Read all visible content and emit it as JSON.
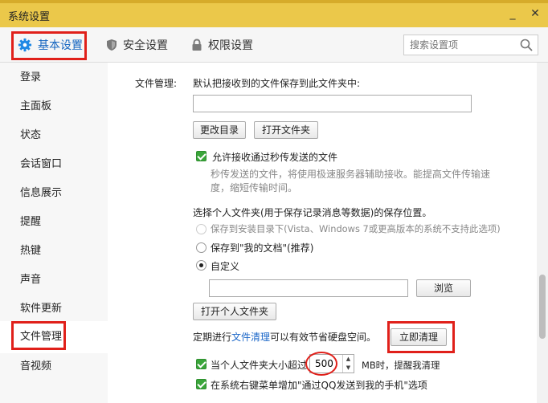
{
  "window": {
    "title": "系统设置",
    "minimize": "_",
    "close": "✕"
  },
  "toolbar": {
    "tabs": [
      {
        "label": "基本设置",
        "icon": "gear-icon"
      },
      {
        "label": "安全设置",
        "icon": "shield-icon"
      },
      {
        "label": "权限设置",
        "icon": "lock-icon"
      }
    ],
    "search_placeholder": "搜索设置项"
  },
  "sidebar": {
    "items": [
      "登录",
      "主面板",
      "状态",
      "会话窗口",
      "信息展示",
      "提醒",
      "热键",
      "声音",
      "软件更新",
      "文件管理",
      "音视频"
    ],
    "active_index": 9
  },
  "file_management": {
    "section_label": "文件管理:",
    "save_folder_text": "默认把接收到的文件保存到此文件夹中:",
    "path_value": "",
    "change_dir_button": "更改目录",
    "open_folder_button": "打开文件夹",
    "allow_flash_label": "允许接收通过秒传发送的文件",
    "flash_desc_line1": "秒传发送的文件，将使用极速服务器辅助接收。能提高文件传输速",
    "flash_desc_line2": "度，缩短传输时间。",
    "personal_folder_title": "选择个人文件夹(用于保存记录消息等数据)的保存位置。",
    "option_install_dir": "保存到安装目录下(Vista、Windows 7或更高版本的系统不支持此选项)",
    "option_my_docs": "保存到\"我的文档\"(推荐)",
    "option_custom": "自定义",
    "custom_path_value": "",
    "browse_button": "浏览",
    "open_personal_button": "打开个人文件夹",
    "cleanup_prefix": "定期进行",
    "cleanup_link": "文件清理",
    "cleanup_suffix": "可以有效节省硬盘空间。",
    "cleanup_now_button": "立即清理",
    "size_limit_prefix": "当个人文件夹大小超过",
    "size_limit_value": "500",
    "size_limit_suffix": "MB时，提醒我清理",
    "context_menu_label": "在系统右键菜单增加\"通过QQ发送到我的手机\"选项"
  }
}
